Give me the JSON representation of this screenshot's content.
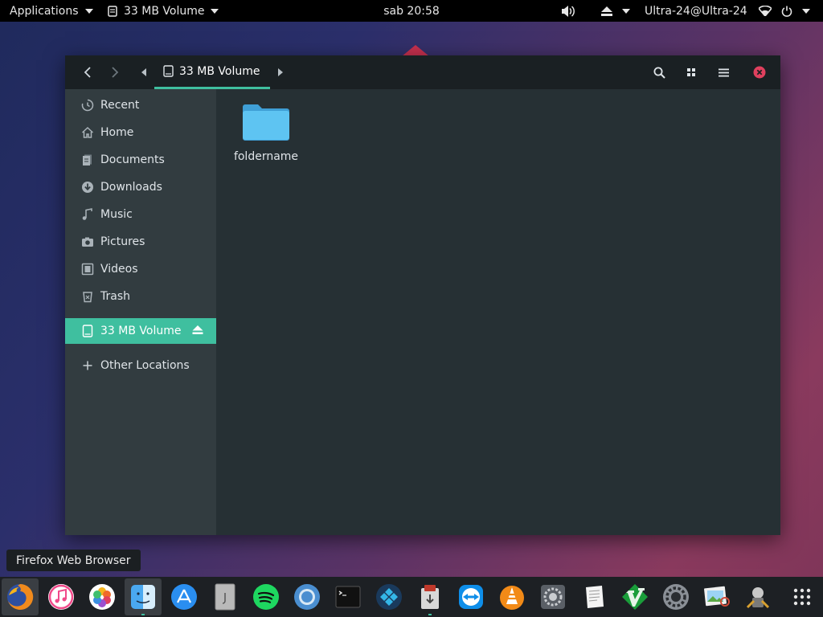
{
  "topbar": {
    "applications_label": "Applications",
    "window_label": "33 MB Volume",
    "clock": "sab 20:58",
    "user_label": "Ultra-24@Ultra-24"
  },
  "window": {
    "path_current": "33 MB Volume"
  },
  "sidebar": {
    "items": [
      {
        "label": "Recent",
        "icon": "recent-icon"
      },
      {
        "label": "Home",
        "icon": "home-icon"
      },
      {
        "label": "Documents",
        "icon": "documents-icon"
      },
      {
        "label": "Downloads",
        "icon": "downloads-icon"
      },
      {
        "label": "Music",
        "icon": "music-icon"
      },
      {
        "label": "Pictures",
        "icon": "pictures-icon"
      },
      {
        "label": "Videos",
        "icon": "videos-icon"
      },
      {
        "label": "Trash",
        "icon": "trash-icon"
      }
    ],
    "device": {
      "label": "33 MB Volume",
      "icon": "drive-icon"
    },
    "other": {
      "label": "Other Locations",
      "icon": "plus-icon"
    }
  },
  "content": {
    "items": [
      {
        "name": "foldername",
        "type": "folder"
      }
    ]
  },
  "tooltip": "Firefox Web Browser",
  "dock": [
    {
      "name": "firefox",
      "icon": "firefox-icon"
    },
    {
      "name": "itunes",
      "icon": "itunes-icon"
    },
    {
      "name": "photos",
      "icon": "photos-icon"
    },
    {
      "name": "files",
      "icon": "finder-icon"
    },
    {
      "name": "app-store",
      "icon": "app-store-icon"
    },
    {
      "name": "archive",
      "icon": "archive-icon"
    },
    {
      "name": "spotify",
      "icon": "spotify-icon"
    },
    {
      "name": "chromium",
      "icon": "chromium-icon"
    },
    {
      "name": "terminal",
      "icon": "terminal-icon"
    },
    {
      "name": "kodi",
      "icon": "kodi-icon"
    },
    {
      "name": "installer",
      "icon": "installer-icon"
    },
    {
      "name": "teamviewer",
      "icon": "teamviewer-icon"
    },
    {
      "name": "vlc",
      "icon": "vlc-icon"
    },
    {
      "name": "system-prefs",
      "icon": "system-prefs-icon"
    },
    {
      "name": "text-editor",
      "icon": "text-editor-icon"
    },
    {
      "name": "vim",
      "icon": "vim-icon"
    },
    {
      "name": "settings",
      "icon": "settings-gear-icon"
    },
    {
      "name": "preview",
      "icon": "preview-icon"
    },
    {
      "name": "automator",
      "icon": "automator-icon"
    },
    {
      "name": "app-grid",
      "icon": "app-grid-icon"
    }
  ],
  "colors": {
    "accent": "#3fbf9f",
    "window_bg": "#263034",
    "sidebar_bg": "#323c40",
    "headerbar_bg": "#1a2023",
    "folder": "#5ec4f2",
    "close": "#e0405e"
  }
}
